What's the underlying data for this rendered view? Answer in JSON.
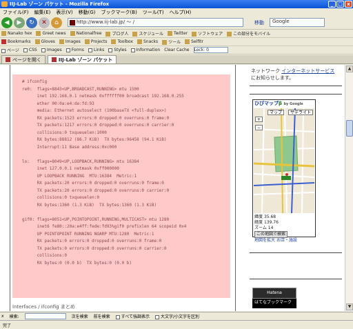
{
  "window": {
    "title": "IIJ-Lab ゾーン パケット - Mozilla Firefox",
    "min": "_",
    "max": "□",
    "close": "x"
  },
  "menu": [
    "ファイル(F)",
    "編集(E)",
    "表示(V)",
    "移動(G)",
    "ブックマーク(B)",
    "ツール(T)",
    "ヘルプ(H)"
  ],
  "nav": {
    "url": "http://www.iij-lab.jp/ 〜 /",
    "go_label": "移動",
    "search_placeholder": "Google"
  },
  "bookmarks1": [
    "Nanako hex",
    "Greet news",
    "Nationalfree",
    "ブログ人",
    "スケジュール",
    "Twitter",
    "ソフトウェア",
    "この部分をモバイル"
  ],
  "bookmarks2": [
    "Bookmarks",
    "Gloves",
    "Images",
    "Projects",
    "Toolbox",
    "Snacks",
    "ツール",
    "Selfitr"
  ],
  "toolbar3": {
    "items": [
      "ページ",
      "CSS",
      "Images",
      "Forms",
      "Links",
      "Styles",
      "Information",
      "Clear Cache"
    ],
    "dropdown": "Lock: 0"
  },
  "tabs": [
    "ページを開く",
    "IIJ-Lab ゾーン パケット"
  ],
  "code_text": "# ifconfig\nre0:  flags=8843<UP,BROADCAST,RUNNING> mtu 1500\n      inet 192.168.0.1 netmask 0xffffff00 broadcast 192.168.0.255\n      ether 00:0a:e4:de:fd:93\n      media: Ethernet autoselect (100baseTX <full-duplex>)\n      RX packets:1523 errors:0 dropped:0 overruns:0 frame:0\n      TX packets:1217 errors:0 dropped:0 overruns:0 carrier:0\n      collisions:0 txqueuelen:1000\n      RX bytes:88812 (86.7 KiB)  TX bytes:96458 (94.1 KiB)\n      Interrupt:11 Base address:0xc000\n\nlo:   flags=8049<UP,LOOPBACK,RUNNING> mtu 16384\n      inet 127.0.0.1 netmask 0xff000000\n      UP LOOPBACK RUNNING  MTU:16384  Metric:1\n      RX packets:20 errors:0 dropped:0 overruns:0 frame:0\n      TX packets:20 errors:0 dropped:0 overruns:0 carrier:0\n      collisions:0 txqueuelen:0\n      RX bytes:1360 (1.3 KiB)  TX bytes:1360 (1.3 KiB)\n\ngif0: flags=8051<UP,POINTOPOINT,RUNNING,MULTICAST> mtu 1280\n      inet6 fe80::20a:e4ff:fede:fd93%gif0 prefixlen 64 scopeid 0x4\n      UP POINTOPOINT RUNNING NOARP MTU:1280  Metric:1\n      RX packets:0 errors:0 dropped:0 overruns:0 frame:0\n      TX packets:0 errors:0 dropped:0 overruns:0 carrier:0\n      collisions:0\n      RX bytes:0 (0.0 b)  TX bytes:0 (0.0 b)",
  "below_text": "Interfaces / ifconfig まとめ",
  "ad": {
    "line1": "ネットワーク",
    "link": "インターネットサービス",
    "line2": "にお知らせします。"
  },
  "map": {
    "title": "ひびマップ",
    "title_g": "β",
    "title_suffix": "by Google",
    "btn_map": "マップ",
    "btn_sat": "サテライト",
    "lat_label": "緯度",
    "lat": "35.68",
    "lng_label": "経度",
    "lng": "139.76",
    "zoom_label": "ズーム",
    "zoom": "14",
    "search_btn": "この地図で検索",
    "link1": "地図を拡大",
    "link2": "お店・施設"
  },
  "right_boxes": {
    "box1": "Hatena",
    "box2": "はてなブックマーク"
  },
  "findbar": {
    "close": "x",
    "label": "検索:",
    "next": "次を検索",
    "prev": "前を検索",
    "highlight": "すべて強調表示",
    "match_case": "大文字/小文字を区別"
  },
  "status": "完了"
}
